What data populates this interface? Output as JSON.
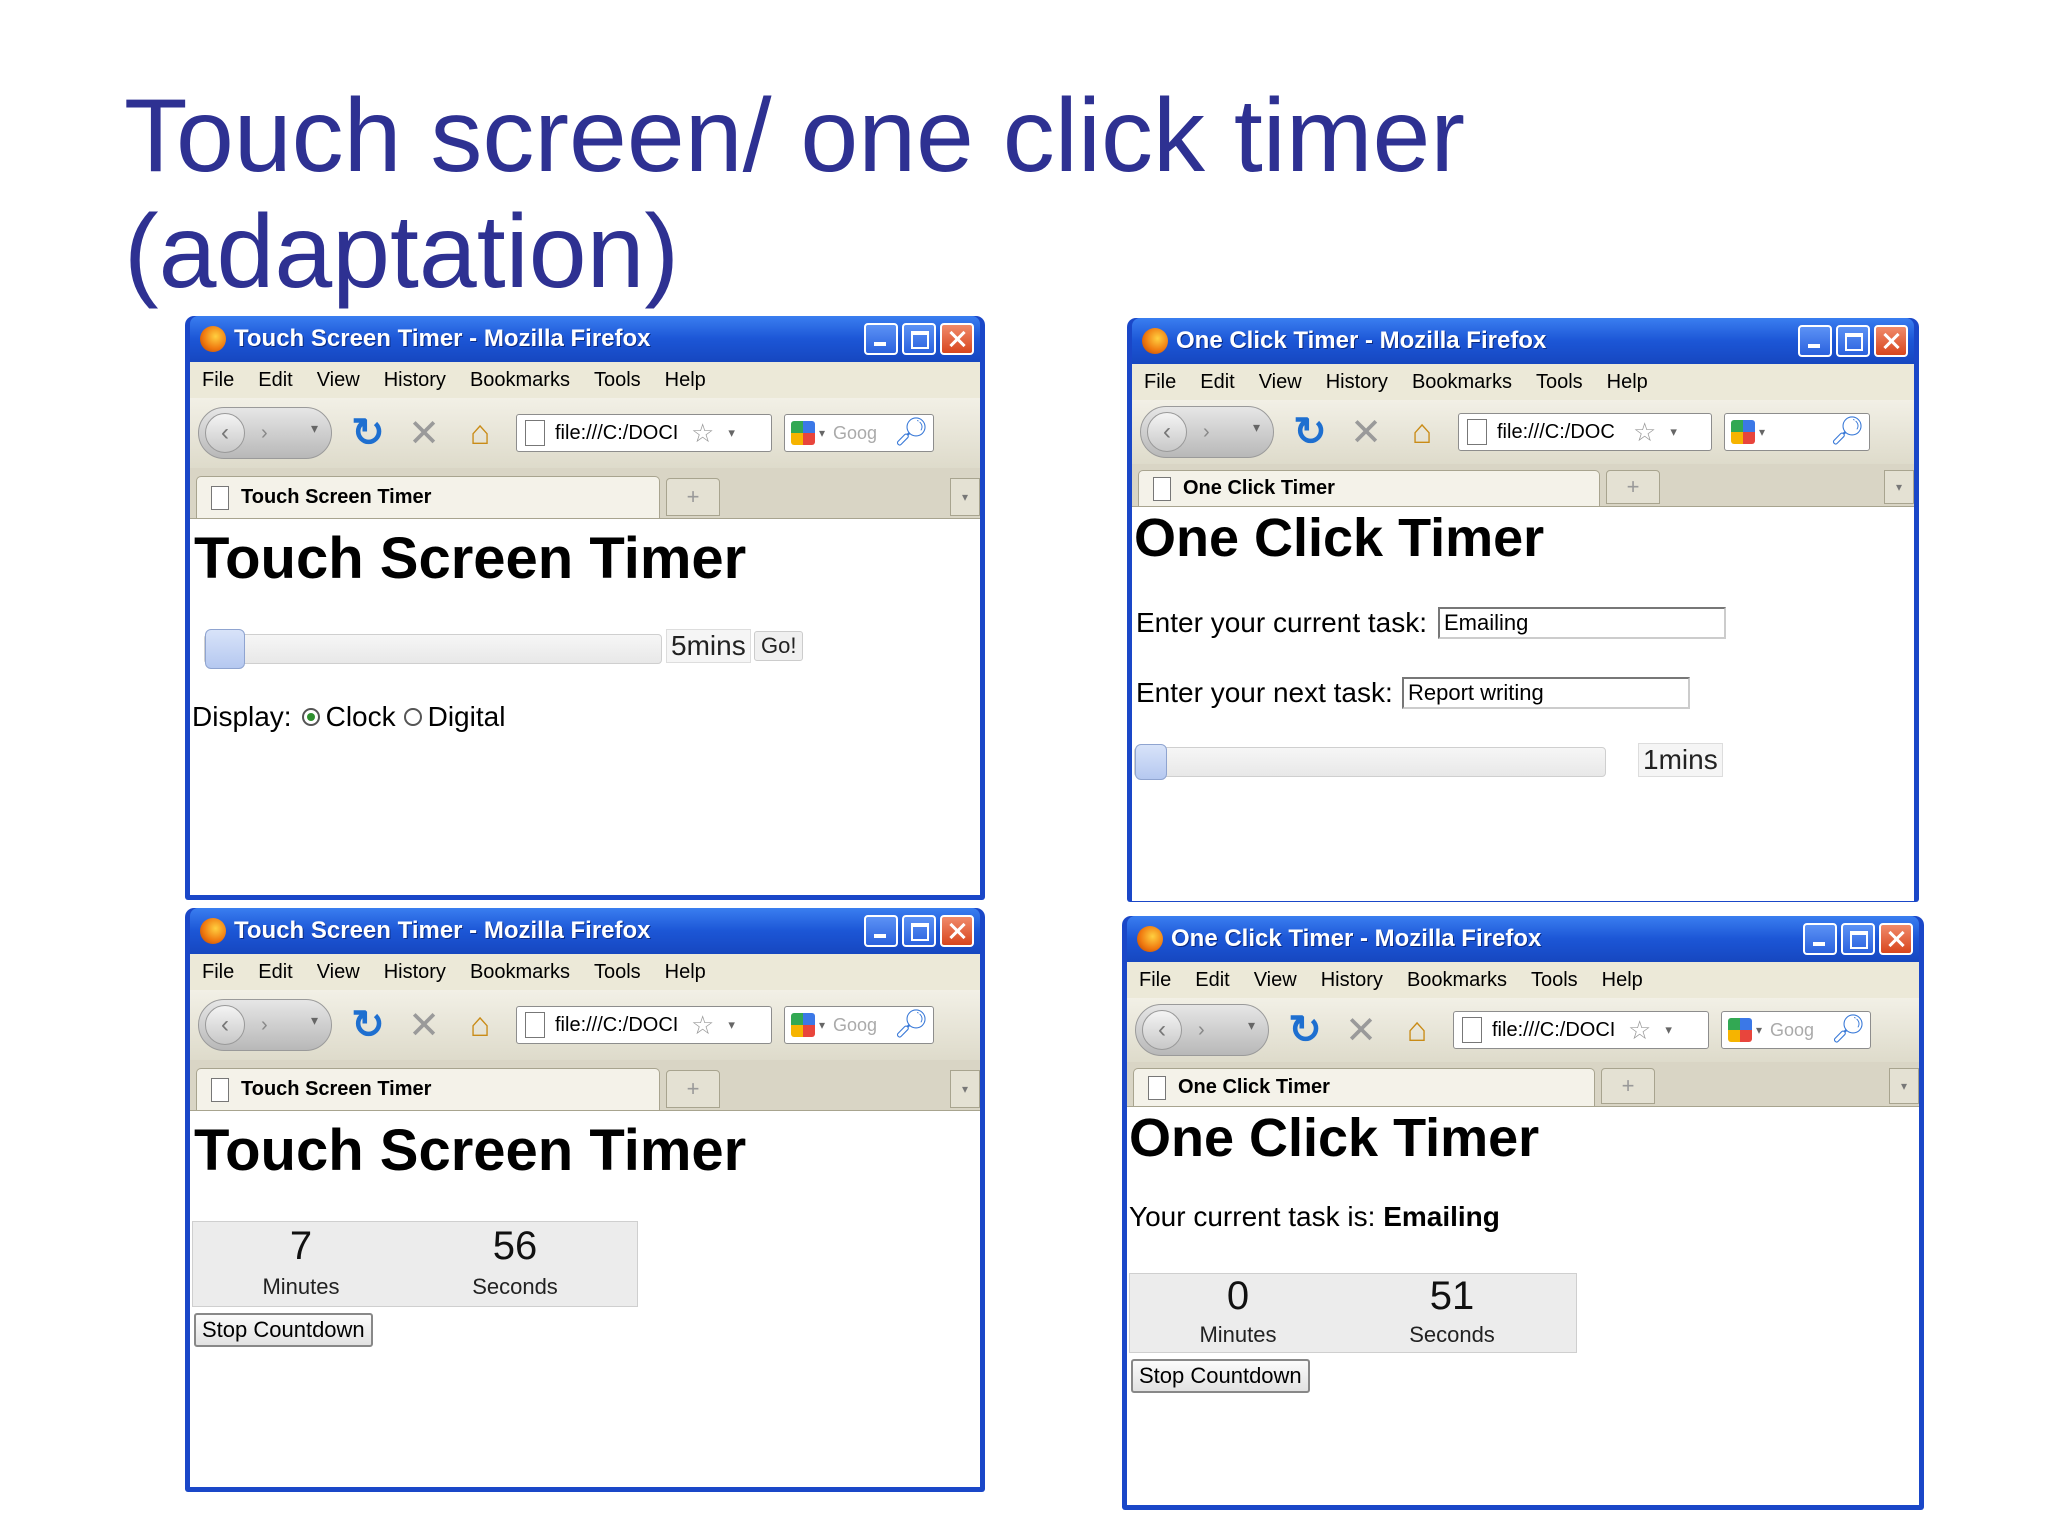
{
  "slide": {
    "title_line1": "Touch screen/ one click timer",
    "title_line2": "(adaptation)"
  },
  "browser": {
    "menu": [
      "File",
      "Edit",
      "View",
      "History",
      "Bookmarks",
      "Tools",
      "Help"
    ],
    "url": "file:///C:/DOCI",
    "search_placeholder": "Goog",
    "new_tab": "+"
  },
  "windows": {
    "touch_setup": {
      "window_title": "Touch Screen Timer - Mozilla Firefox",
      "tab_title": "Touch Screen Timer",
      "heading": "Touch Screen Timer",
      "slider_value": "5mins",
      "go_label": "Go!",
      "display_label": "Display:",
      "option_clock": "Clock",
      "option_digital": "Digital",
      "selected_option": "Clock"
    },
    "one_click_setup": {
      "window_title": "One Click Timer - Mozilla Firefox",
      "tab_title": "One Click Timer",
      "url": "file:///C:/DOC",
      "heading": "One Click Timer",
      "current_task_label": "Enter your current task:",
      "current_task_value": "Emailing",
      "next_task_label": "Enter your next task:",
      "next_task_value": "Report writing",
      "slider_value": "1mins"
    },
    "touch_running": {
      "window_title": "Touch Screen Timer - Mozilla Firefox",
      "tab_title": "Touch Screen Timer",
      "heading": "Touch Screen Timer",
      "minutes": "7",
      "minutes_label": "Minutes",
      "seconds": "56",
      "seconds_label": "Seconds",
      "stop_label": "Stop Countdown"
    },
    "one_click_running": {
      "window_title": "One Click Timer - Mozilla Firefox",
      "tab_title": "One Click Timer",
      "heading": "One Click Timer",
      "task_prefix": "Your current task is:",
      "task_value": "Emailing",
      "minutes": "0",
      "minutes_label": "Minutes",
      "seconds": "51",
      "seconds_label": "Seconds",
      "stop_label": "Stop Countdown"
    }
  },
  "colors": {
    "title": "#2e3192",
    "window_frame": "#1a47c8",
    "titlebar": "#2a63de"
  }
}
